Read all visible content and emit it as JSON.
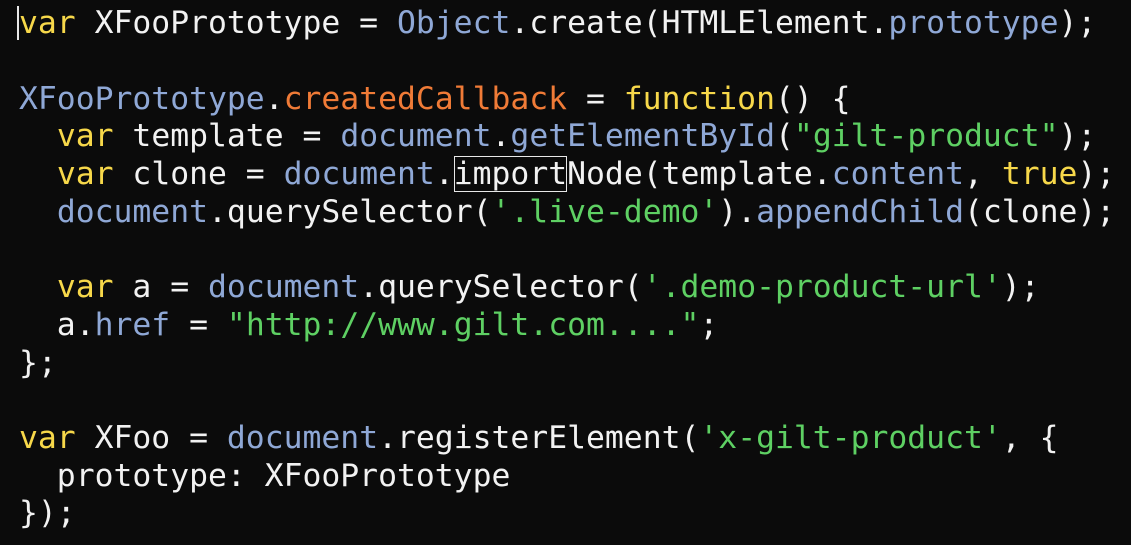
{
  "editor": {
    "lines": [
      [
        {
          "t": "var",
          "c": "kw"
        },
        {
          "t": " XFooPrototype = ",
          "c": "plain"
        },
        {
          "t": "Object",
          "c": "obj"
        },
        {
          "t": ".create(HTMLElement.",
          "c": "plain"
        },
        {
          "t": "prototype",
          "c": "obj"
        },
        {
          "t": ");",
          "c": "plain"
        }
      ],
      [],
      [
        {
          "t": "XFooPrototype",
          "c": "obj"
        },
        {
          "t": ".",
          "c": "plain"
        },
        {
          "t": "createdCallback",
          "c": "orange"
        },
        {
          "t": " = ",
          "c": "plain"
        },
        {
          "t": "function",
          "c": "kw"
        },
        {
          "t": "() {",
          "c": "plain"
        }
      ],
      [
        {
          "t": "  ",
          "c": "plain"
        },
        {
          "t": "var",
          "c": "kw"
        },
        {
          "t": " template = ",
          "c": "plain"
        },
        {
          "t": "document",
          "c": "obj"
        },
        {
          "t": ".",
          "c": "plain"
        },
        {
          "t": "getElementById",
          "c": "obj"
        },
        {
          "t": "(",
          "c": "plain"
        },
        {
          "t": "\"gilt-product\"",
          "c": "str"
        },
        {
          "t": ");",
          "c": "plain"
        }
      ],
      [
        {
          "t": "  ",
          "c": "plain"
        },
        {
          "t": "var",
          "c": "kw"
        },
        {
          "t": " clone = ",
          "c": "plain"
        },
        {
          "t": "document",
          "c": "obj"
        },
        {
          "t": ".",
          "c": "plain"
        },
        {
          "t": "import",
          "c": "boxed"
        },
        {
          "t": "Node(template.",
          "c": "plain"
        },
        {
          "t": "content",
          "c": "obj"
        },
        {
          "t": ", ",
          "c": "plain"
        },
        {
          "t": "true",
          "c": "bool"
        },
        {
          "t": ");",
          "c": "plain"
        }
      ],
      [
        {
          "t": "  ",
          "c": "plain"
        },
        {
          "t": "document",
          "c": "obj"
        },
        {
          "t": ".querySelector(",
          "c": "plain"
        },
        {
          "t": "'.live-demo'",
          "c": "str"
        },
        {
          "t": ").",
          "c": "plain"
        },
        {
          "t": "appendChild",
          "c": "obj"
        },
        {
          "t": "(clone);",
          "c": "plain"
        }
      ],
      [],
      [
        {
          "t": "  ",
          "c": "plain"
        },
        {
          "t": "var",
          "c": "kw"
        },
        {
          "t": " a = ",
          "c": "plain"
        },
        {
          "t": "document",
          "c": "obj"
        },
        {
          "t": ".querySelector(",
          "c": "plain"
        },
        {
          "t": "'.demo-product-url'",
          "c": "str"
        },
        {
          "t": ");",
          "c": "plain"
        }
      ],
      [
        {
          "t": "  a.",
          "c": "plain"
        },
        {
          "t": "href",
          "c": "obj"
        },
        {
          "t": " = ",
          "c": "plain"
        },
        {
          "t": "\"http://www.gilt.com....\"",
          "c": "str"
        },
        {
          "t": ";",
          "c": "plain"
        }
      ],
      [
        {
          "t": "};",
          "c": "plain"
        }
      ],
      [],
      [
        {
          "t": "var",
          "c": "kw"
        },
        {
          "t": " XFoo = ",
          "c": "plain"
        },
        {
          "t": "document",
          "c": "obj"
        },
        {
          "t": ".registerElement(",
          "c": "plain"
        },
        {
          "t": "'x-gilt-product'",
          "c": "str"
        },
        {
          "t": ", {",
          "c": "plain"
        }
      ],
      [
        {
          "t": "  prototype: XFooPrototype",
          "c": "plain"
        }
      ],
      [
        {
          "t": "});",
          "c": "plain"
        }
      ]
    ]
  }
}
